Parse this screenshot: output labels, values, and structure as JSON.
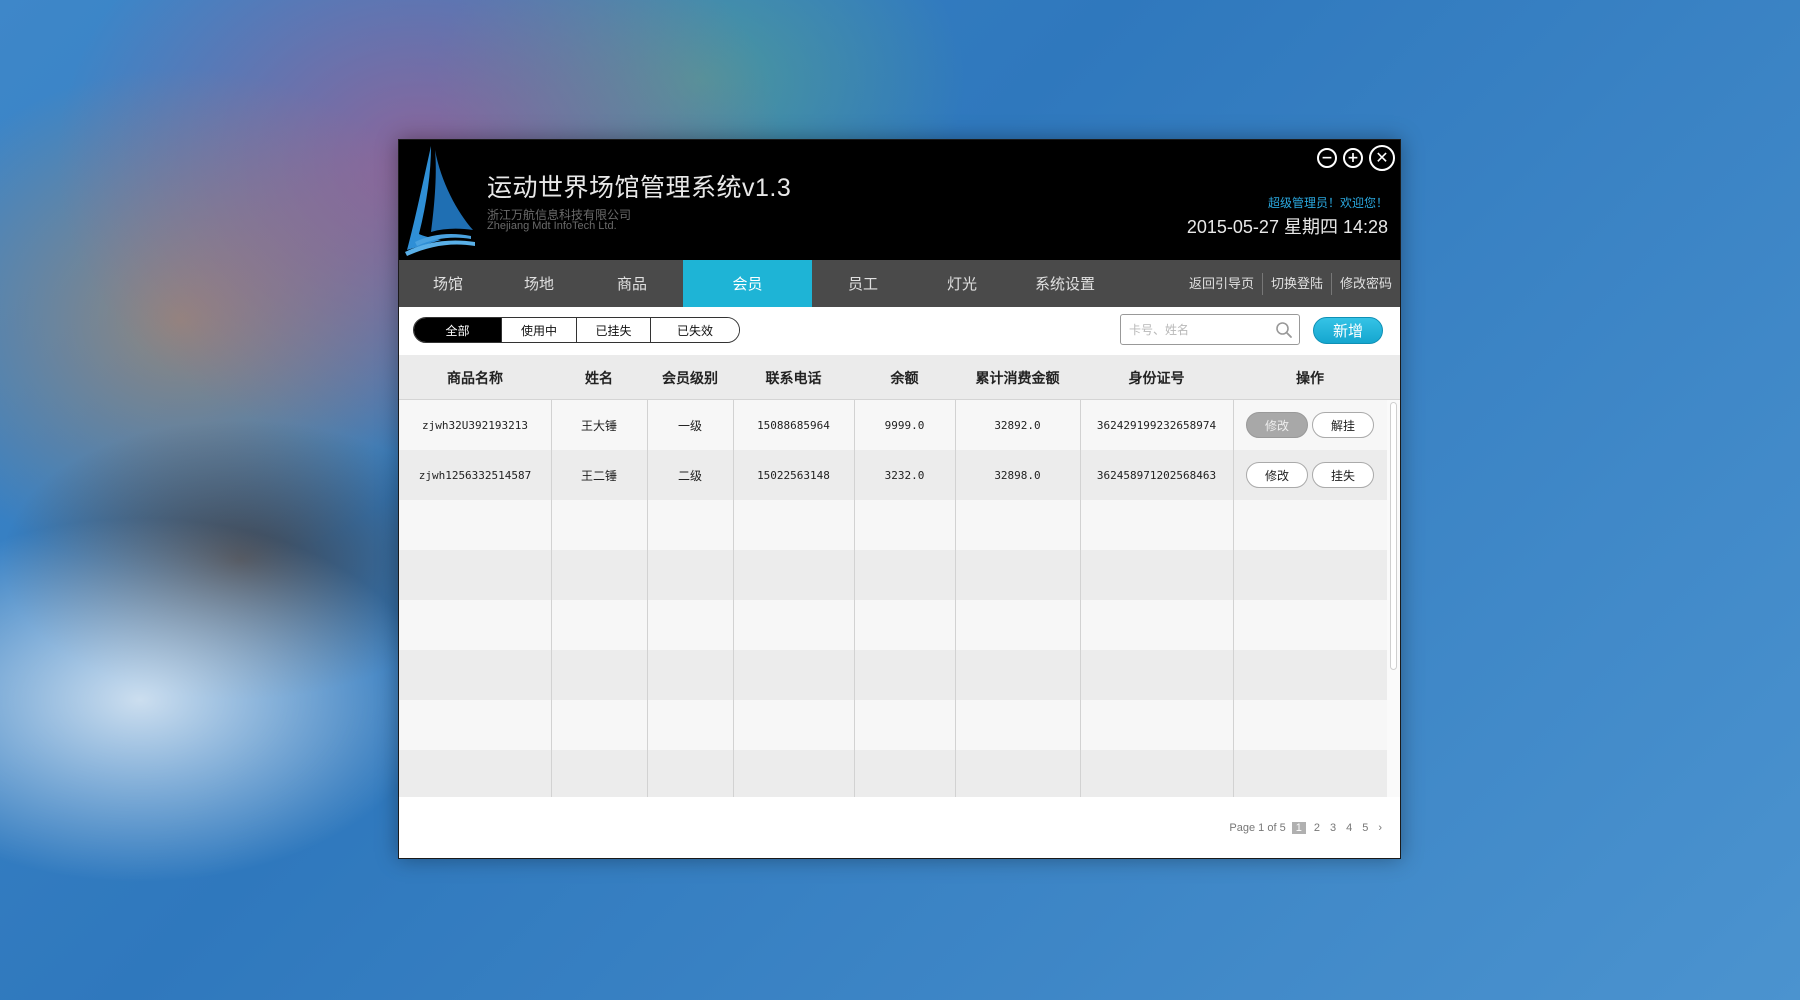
{
  "app": {
    "title": "运动世界场馆管理系统v1.3",
    "company_cn": "浙江万航信息科技有限公司",
    "company_en": "Zhejiang Mdt InfoTech Ltd.",
    "welcome": "超级管理员！欢迎您！",
    "datetime": "2015-05-27 星期四 14:28",
    "controls": {
      "minimize": "−",
      "maximize": "+",
      "close": "✕"
    }
  },
  "nav": {
    "items": [
      {
        "label": "场馆"
      },
      {
        "label": "场地"
      },
      {
        "label": "商品"
      },
      {
        "label": "会员"
      },
      {
        "label": "员工"
      },
      {
        "label": "灯光"
      },
      {
        "label": "系统设置"
      }
    ],
    "active": "会员",
    "links": [
      {
        "label": "返回引导页"
      },
      {
        "label": "切换登陆"
      },
      {
        "label": "修改密码"
      }
    ]
  },
  "filters": {
    "items": [
      {
        "label": "全部"
      },
      {
        "label": "使用中"
      },
      {
        "label": "已挂失"
      },
      {
        "label": "已失效"
      }
    ],
    "active": "全部"
  },
  "search": {
    "placeholder": "卡号、姓名",
    "value": ""
  },
  "add_button": "新增",
  "table": {
    "headers": [
      "商品名称",
      "姓名",
      "会员级别",
      "联系电话",
      "余额",
      "累计消费金额",
      "身份证号",
      "操作"
    ],
    "rows": [
      [
        "zjwh32U392193213",
        "王大锤",
        "一级",
        "15088685964",
        "9999.0",
        "32892.0",
        "362429199232658974"
      ],
      [
        "zjwh1256332514587",
        "王二锤",
        "二级",
        "15022563148",
        "3232.0",
        "32898.0",
        "362458971202568463"
      ]
    ],
    "row_actions": [
      {
        "edit": "修改",
        "edit_disabled": true,
        "status_action": "解挂"
      },
      {
        "edit": "修改",
        "edit_disabled": false,
        "status_action": "挂失"
      }
    ]
  },
  "pager": {
    "label": "Page 1 of 5",
    "pages": [
      "1",
      "2",
      "3",
      "4",
      "5"
    ],
    "current": "1",
    "next": "›"
  },
  "colors": {
    "accent": "#1eb4d6",
    "titlebar": "#000000",
    "navbar": "#4a4a4a",
    "welcome": "#2aa7de"
  }
}
